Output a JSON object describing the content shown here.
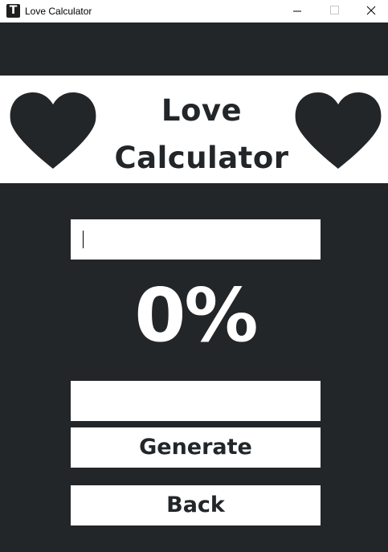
{
  "window": {
    "title": "Love Calculator",
    "app_icon_glyph": "T",
    "controls": [
      "minimize-icon",
      "maximize-icon",
      "close-icon"
    ]
  },
  "header": {
    "title_line1": "Love",
    "title_line2": "Calculator",
    "icons": [
      "heart-icon",
      "heart-icon"
    ]
  },
  "form": {
    "name_input_value": "",
    "result_text": "0%",
    "result_output_value": ""
  },
  "buttons": {
    "generate_label": "Generate",
    "back_label": "Back"
  },
  "colors": {
    "background": "#232629",
    "panel": "#ffffff",
    "text_dark": "#232629",
    "text_light": "#ffffff"
  }
}
